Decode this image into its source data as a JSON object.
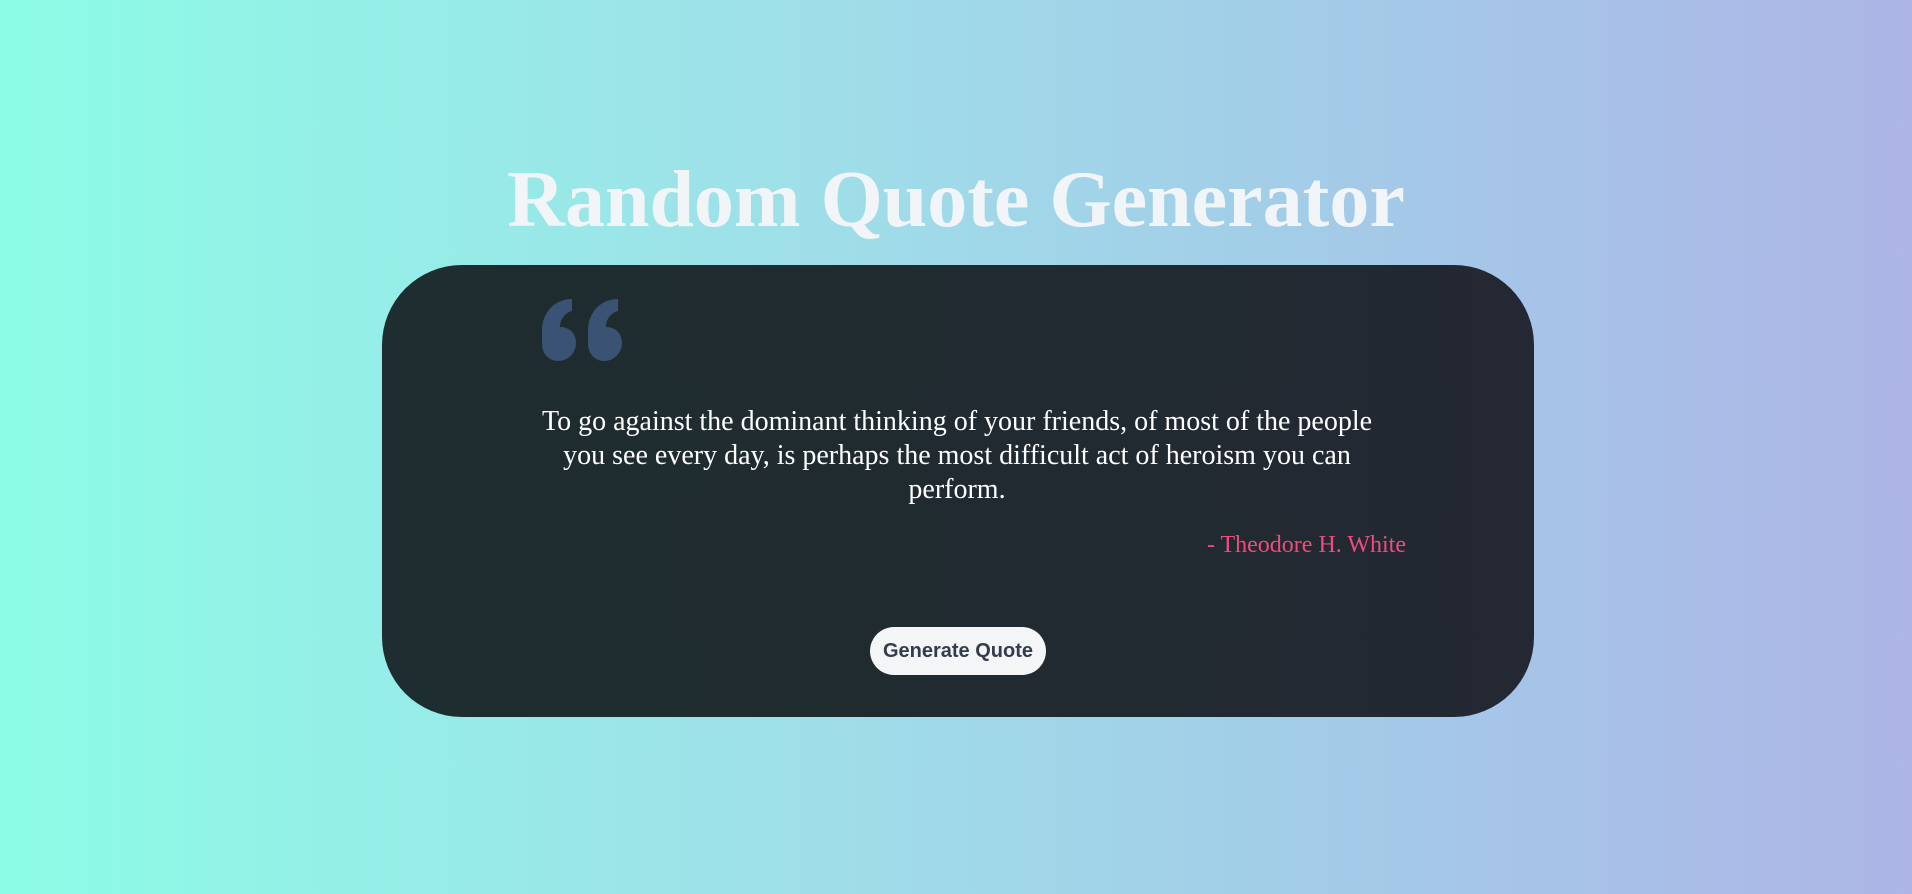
{
  "header": {
    "title": "Random Quote Generator"
  },
  "quote_card": {
    "icon": "quote-left-icon",
    "text": "To go against the dominant thinking of your friends, of most of the people you see every day, is perhaps the most difficult act of heroism you can perform.",
    "author": "- Theodore H. White",
    "generate_button_label": "Generate Quote"
  },
  "colors": {
    "background_start": "#8cfce6",
    "background_end": "#adb5e6",
    "card": "#1f2b30",
    "quote_icon": "#3a5273",
    "author": "#f14b7d",
    "button": "#f4f5f7",
    "button_text": "#333d4e"
  }
}
